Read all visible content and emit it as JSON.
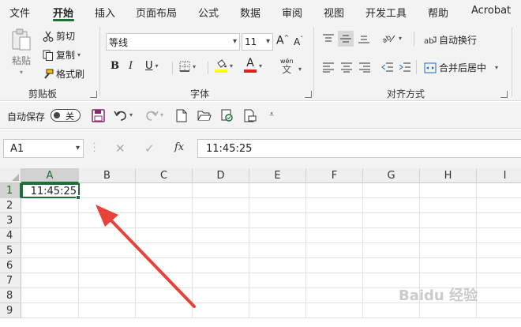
{
  "ribbon_tabs": [
    "文件",
    "开始",
    "插入",
    "页面布局",
    "公式",
    "数据",
    "审阅",
    "视图",
    "开发工具",
    "帮助",
    "Acrobat"
  ],
  "active_tab": "开始",
  "clipboard": {
    "paste_label": "粘贴",
    "cut_label": "剪切",
    "copy_label": "复制",
    "format_painter_label": "格式刷",
    "group_label": "剪贴板"
  },
  "font": {
    "font_name": "等线",
    "font_size": "11",
    "bold_label": "B",
    "italic_label": "I",
    "underline_label": "U",
    "wen_label": "wén",
    "wen_char": "文",
    "group_label": "字体",
    "fill_color": "#ffff00",
    "font_color": "#e02020"
  },
  "alignment": {
    "wrap_text_label": "自动换行",
    "merge_center_label": "合并后居中",
    "group_label": "对齐方式"
  },
  "qat": {
    "autosave_label": "自动保存",
    "autosave_state": "关"
  },
  "formula_bar": {
    "name_box": "A1",
    "formula_value": "11:45:25"
  },
  "sheet": {
    "columns": [
      "A",
      "B",
      "C",
      "D",
      "E",
      "F",
      "G",
      "H",
      "I"
    ],
    "rows": [
      "1",
      "2",
      "3",
      "4",
      "5",
      "6",
      "7",
      "8",
      "9"
    ],
    "selected_cell": "A1",
    "a1_value": "11:45:25"
  },
  "watermark": "Baidu 经验",
  "colors": {
    "accent_green": "#1e6e3a",
    "annotation_arrow": "#e8423a"
  }
}
